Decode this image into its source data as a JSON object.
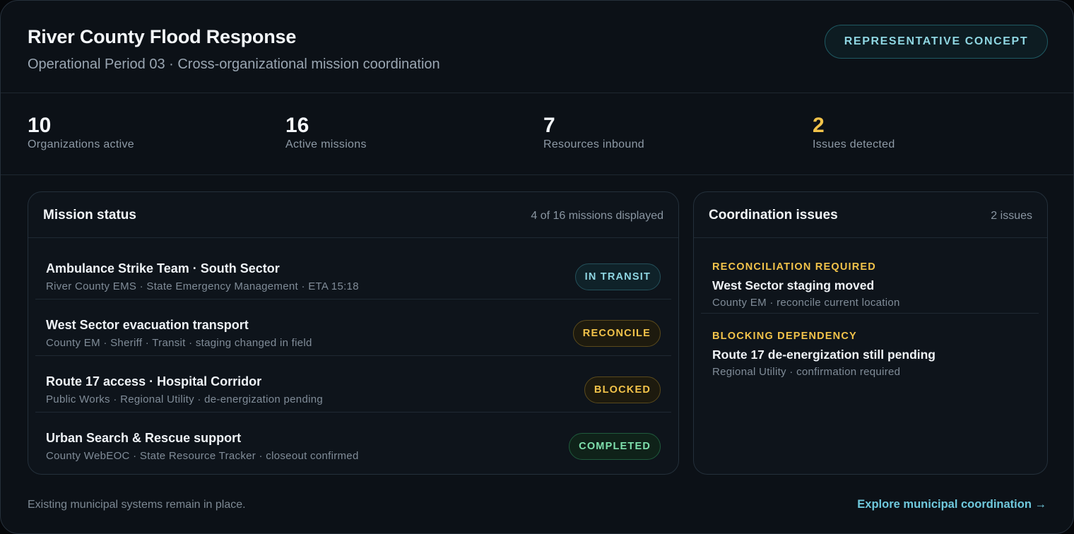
{
  "header": {
    "title": "River County Flood Response",
    "subtitle": "Operational Period 03 · Cross-organizational mission coordination",
    "badge": "REPRESENTATIVE CONCEPT"
  },
  "stats": [
    {
      "value": "10",
      "label": "Organizations active"
    },
    {
      "value": "16",
      "label": "Active missions"
    },
    {
      "value": "7",
      "label": "Resources inbound"
    },
    {
      "value": "2",
      "label": "Issues detected"
    }
  ],
  "mission_panel": {
    "title": "Mission status",
    "meta": "4 of 16 missions displayed",
    "missions": [
      {
        "name": "Ambulance Strike Team · South Sector",
        "detail": "River County EMS · State Emergency Management · ETA 15:18",
        "status": "IN TRANSIT"
      },
      {
        "name": "West Sector evacuation transport",
        "detail": "County EM · Sheriff · Transit · staging changed in field",
        "status": "RECONCILE"
      },
      {
        "name": "Route 17 access · Hospital Corridor",
        "detail": "Public Works · Regional Utility · de-energization pending",
        "status": "BLOCKED"
      },
      {
        "name": "Urban Search & Rescue support",
        "detail": "County WebEOC · State Resource Tracker · closeout confirmed",
        "status": "COMPLETED"
      }
    ]
  },
  "issues_panel": {
    "title": "Coordination issues",
    "meta": "2 issues",
    "issues": [
      {
        "tag": "RECONCILIATION REQUIRED",
        "title": "West Sector staging moved",
        "detail": "County EM · reconcile current location"
      },
      {
        "tag": "BLOCKING DEPENDENCY",
        "title": "Route 17 de-energization still pending",
        "detail": "Regional Utility · confirmation required"
      }
    ]
  },
  "footer": {
    "note": "Existing municipal systems remain in place.",
    "link": "Explore municipal coordination →"
  },
  "colors": {
    "background": "#0c1117",
    "accent_cyan": "#8fd6e2",
    "warning_amber": "#f2c34a",
    "success_green": "#7fe0ad"
  }
}
